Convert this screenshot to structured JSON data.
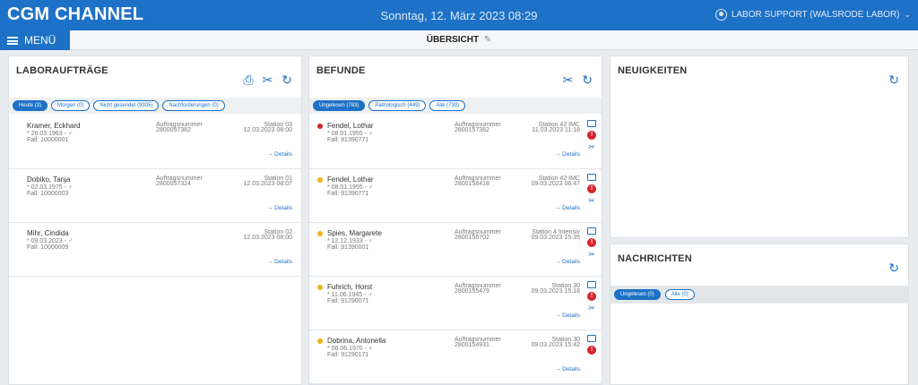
{
  "header": {
    "brand": "CGM CHANNEL",
    "datetime": "Sonntag, 12. März 2023 08:29",
    "user": "LABOR SUPPORT (WALSRODE LABOR)"
  },
  "subbar": {
    "menu_label": "MENÜ",
    "overview_label": "ÜBERSICHT"
  },
  "labor": {
    "title": "LABORAUFTRÄGE",
    "filters": [
      "Heute (3)",
      "Morgen (0)",
      "Nicht gesendet (9305)",
      "Nachforderungen (0)"
    ],
    "items": [
      {
        "name": "Kramer, Eckhard",
        "sub1": "* 26.03.1963 - ♂",
        "sub2": "Fall: 10000001",
        "col2a": "Auftragsnummer",
        "col2b": "2800057382",
        "col3a": "Station 03",
        "col3b": "12.03.2023 08:00",
        "details": "→ Details"
      },
      {
        "name": "Dobiko, Tanja",
        "sub1": "* 02.03.1975 - ♀",
        "sub2": "Fall: 10000003",
        "col2a": "Auftragsnummer",
        "col2b": "2800057324",
        "col3a": "Station 01",
        "col3b": "12.03.2023 08:07",
        "details": "→ Details"
      },
      {
        "name": "Mihr, Cindida",
        "sub1": "* 09.03.2023 - ♂",
        "sub2": "Fall: 10000009",
        "col2a": "",
        "col2b": "",
        "col3a": "Station 02",
        "col3b": "12.03.2023 08:00",
        "details": "→ Details"
      }
    ]
  },
  "befunde": {
    "title": "BEFUNDE",
    "filters": [
      "Ungelesen (783)",
      "Pathologisch (449)",
      "Alle (739)"
    ],
    "items": [
      {
        "status": "red",
        "name": "Fendel, Lothar",
        "sub1": "* 08.01.1955 - ♂",
        "sub2": "Fall: 91390771",
        "col2a": "Auftragsnummer",
        "col2b": "2800157382",
        "col3a": "Station 42 IMC",
        "col3b": "11.03.2023 11:18",
        "details": "→ Details"
      },
      {
        "status": "yellow",
        "name": "Fendel, Lothar",
        "sub1": "* 08.01.1955 - ♂",
        "sub2": "Fall: 91390771",
        "col2a": "Auftragsnummer",
        "col2b": "2800158418",
        "col3a": "Station 42 IMC",
        "col3b": "09.03.2023 06:47",
        "details": "→ Details"
      },
      {
        "status": "yellow",
        "name": "Spies, Margarete",
        "sub1": "* 12.12.1933 - ♀",
        "sub2": "Fall: 91390001",
        "col2a": "Auftragsnummer",
        "col2b": "2800156702",
        "col3a": "Station 4 Intensiv",
        "col3b": "09.03.2023 15:35",
        "details": "→ Details"
      },
      {
        "status": "yellow",
        "name": "Fuhrich, Horst",
        "sub1": "* 11.06.1945 - ♂",
        "sub2": "Fall: 91290071",
        "col2a": "Auftragsnummer",
        "col2b": "2800155479",
        "col3a": "Station 30",
        "col3b": "09.03.2023 15:18",
        "details": "→ Details"
      },
      {
        "status": "yellow",
        "name": "Dobrina, Antonella",
        "sub1": "* 06.06.1970 - ♀",
        "sub2": "Fall: 91290171",
        "col2a": "Auftragsnummer",
        "col2b": "2800154931",
        "col3a": "Station 30",
        "col3b": "09.03.2023 15:42",
        "details": "→ Details"
      }
    ]
  },
  "news": {
    "title": "NEUIGKEITEN"
  },
  "messages": {
    "title": "NACHRICHTEN",
    "filters": [
      "Ungelesen (0)",
      "Alle (0)"
    ]
  },
  "colors": {
    "brand_blue": "#1d71c6",
    "alert_red": "#d9232d",
    "warn_yellow": "#f2b21b"
  }
}
